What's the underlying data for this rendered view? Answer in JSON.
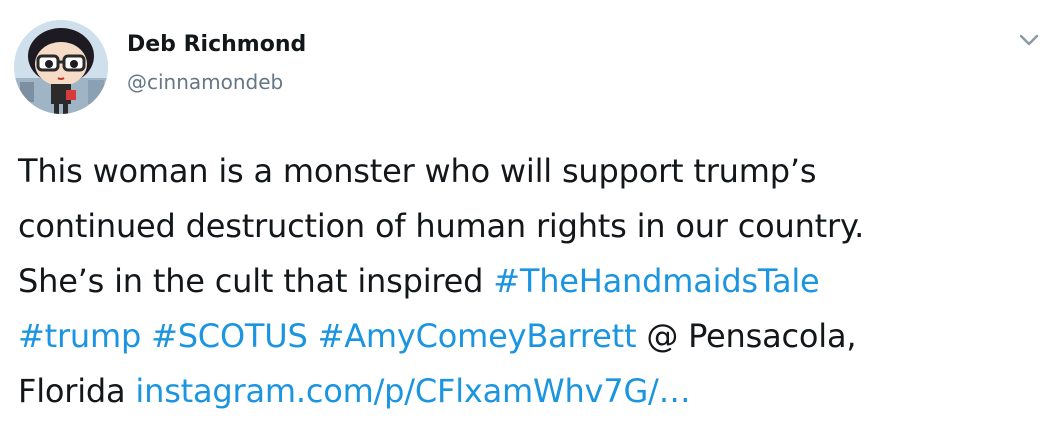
{
  "tweet": {
    "author_name": "Deb Richmond",
    "author_handle": "@cinnamondeb",
    "menu_icon": "chevron-down-icon",
    "avatar_icon": "cartoon-avatar",
    "link_color": "#1b95e0",
    "lines": [
      [
        {
          "text": "This woman is a monster who will support trump’s",
          "link": false
        }
      ],
      [
        {
          "text": "continued destruction of human rights in our country.",
          "link": false
        }
      ],
      [
        {
          "text": "She’s in the cult that inspired ",
          "link": false
        },
        {
          "text": "#TheHandmaidsTale",
          "link": true
        }
      ],
      [
        {
          "text": "#trump",
          "link": true
        },
        {
          "text": " ",
          "link": false
        },
        {
          "text": "#SCOTUS",
          "link": true
        },
        {
          "text": " ",
          "link": false
        },
        {
          "text": "#AmyComeyBarrett",
          "link": true
        },
        {
          "text": " @ Pensacola,",
          "link": false
        }
      ],
      [
        {
          "text": "Florida ",
          "link": false
        },
        {
          "text": "instagram.com/p/CFlxamWhv7G/…",
          "link": true
        }
      ]
    ]
  }
}
